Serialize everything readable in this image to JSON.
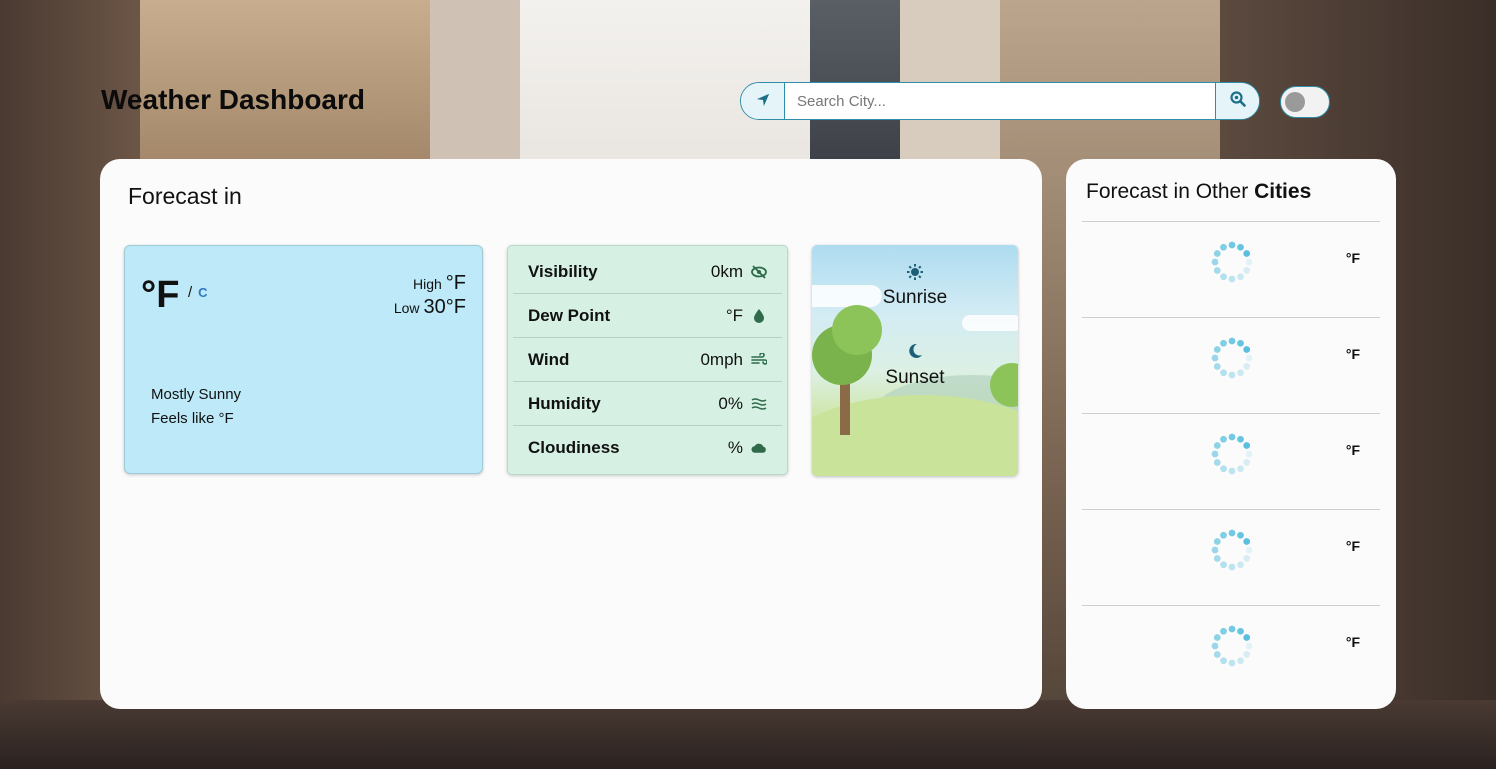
{
  "header": {
    "title": "Weather Dashboard"
  },
  "search": {
    "placeholder": "Search City..."
  },
  "main": {
    "title": "Forecast in",
    "current": {
      "temp": "°F",
      "unit_f": "/",
      "unit_c": "C",
      "high_label": "High",
      "high_value": "°F",
      "low_label": "Low",
      "low_value": "30°F",
      "condition": "Mostly Sunny",
      "feels_like": "Feels like °F"
    },
    "details": [
      {
        "name": "Visibility",
        "value": "0km",
        "icon": "eye-slash-icon"
      },
      {
        "name": "Dew Point",
        "value": "°F",
        "icon": "droplet-icon"
      },
      {
        "name": "Wind",
        "value": "0mph",
        "icon": "wind-icon"
      },
      {
        "name": "Humidity",
        "value": "0%",
        "icon": "water-icon"
      },
      {
        "name": "Cloudiness",
        "value": "%",
        "icon": "cloud-icon"
      }
    ],
    "sun": {
      "sunrise_label": "Sunrise",
      "sunset_label": "Sunset"
    }
  },
  "side": {
    "title_prefix": "Forecast in Other ",
    "title_bold": "Cities",
    "cities": [
      {
        "temp": "°F"
      },
      {
        "temp": "°F"
      },
      {
        "temp": "°F"
      },
      {
        "temp": "°F"
      },
      {
        "temp": "°F"
      }
    ]
  },
  "colors": {
    "accent": "#2e8da8",
    "temp_card": "#bde9f8",
    "details_card": "#d6f1e4",
    "icon_green": "#2f6b4a",
    "spinner": "#5bc0de"
  }
}
